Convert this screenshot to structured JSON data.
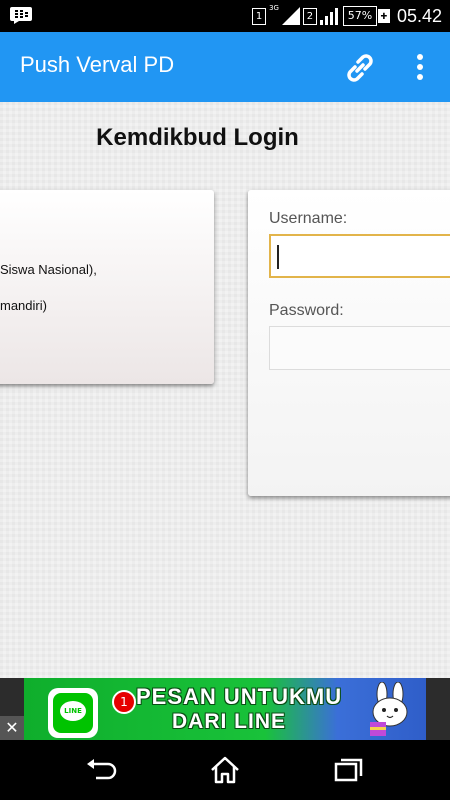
{
  "status_bar": {
    "sim1": "1",
    "sim2": "2",
    "network_type": "3G",
    "battery": "57%",
    "time": "05.42"
  },
  "app_bar": {
    "title": "Push Verval PD",
    "icons": [
      "link-icon",
      "overflow-menu-icon"
    ]
  },
  "login": {
    "heading": "Kemdikbud Login",
    "info_line_1": "Siswa Nasional),",
    "info_line_2": "mandiri)",
    "username_label": "Username:",
    "username_value": "",
    "password_label": "Password:",
    "password_value": ""
  },
  "ad": {
    "close": "✕",
    "badge_count": "1",
    "icon_text": "LINE",
    "line1": "PESAN UNTUKMU",
    "line2": "DARI LINE"
  },
  "nav_bar": {
    "icons": [
      "back-icon",
      "home-icon",
      "recents-icon"
    ]
  },
  "colors": {
    "app_bar": "#2196f3",
    "focus_border": "#e2b44a",
    "line_green": "#00c300"
  }
}
